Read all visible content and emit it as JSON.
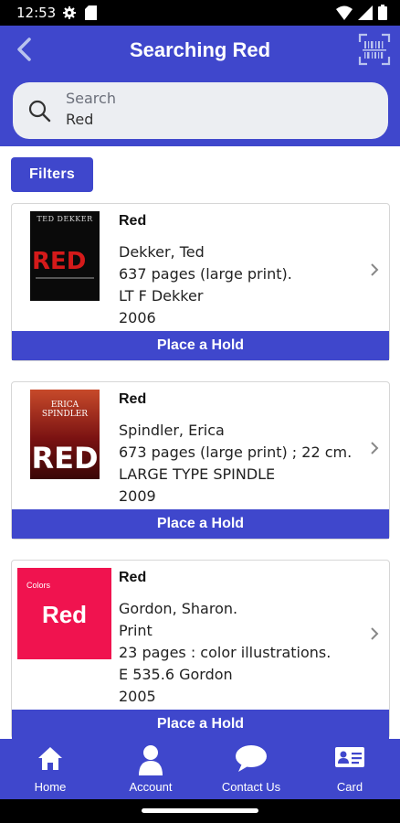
{
  "status_bar": {
    "time": "12:53"
  },
  "header": {
    "title": "Searching Red"
  },
  "search": {
    "label": "Search",
    "value": "Red"
  },
  "filters_label": "Filters",
  "results": [
    {
      "title": "Red",
      "lines": [
        "Dekker, Ted",
        "637 pages (large print).",
        "LT F Dekker",
        "2006"
      ],
      "cover": {
        "top_text": "TED DEKKER",
        "main_text": "RED",
        "bg": "#0a0a0a",
        "fg": "#d41a1a"
      },
      "hold_label": "Place a Hold"
    },
    {
      "title": "Red",
      "lines": [
        "Spindler, Erica",
        "673 pages (large print) ; 22 cm.",
        "LARGE TYPE SPINDLE",
        "2009"
      ],
      "cover": {
        "top_text": "ERICA SPINDLER",
        "main_text": "RED",
        "bg": "#7a1212",
        "fg": "#ffffff"
      },
      "hold_label": "Place a Hold"
    },
    {
      "title": "Red",
      "lines": [
        "Gordon, Sharon.",
        "Print",
        "23 pages : color illustrations.",
        "E 535.6 Gordon",
        "2005"
      ],
      "cover": {
        "top_text": "Colors",
        "main_text": "Red",
        "bg": "#f0134f",
        "fg": "#ffffff"
      },
      "hold_label": "Place a Hold"
    }
  ],
  "nav": [
    {
      "label": "Home",
      "icon": "home-icon"
    },
    {
      "label": "Account",
      "icon": "person-icon"
    },
    {
      "label": "Contact Us",
      "icon": "chat-bubble-icon"
    },
    {
      "label": "Card",
      "icon": "id-card-icon"
    }
  ],
  "colors": {
    "primary": "#3f47cc",
    "search_bg": "#eceef2"
  }
}
